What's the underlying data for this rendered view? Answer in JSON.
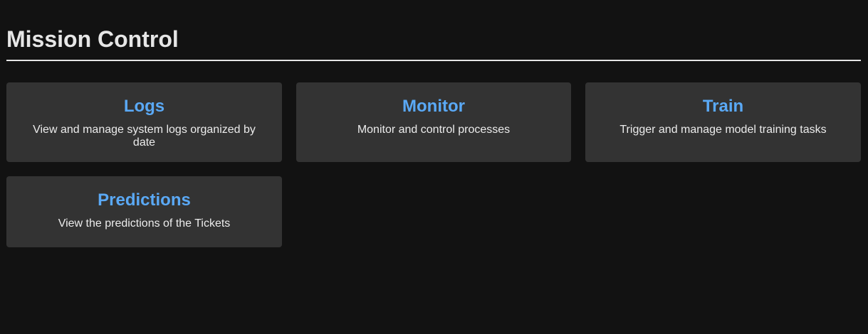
{
  "header": {
    "title": "Mission Control"
  },
  "colors": {
    "background": "#121212",
    "card_background": "#333333",
    "card_title": "#5aa9f6",
    "text": "#e6e6e6"
  },
  "cards": [
    {
      "title": "Logs",
      "description": "View and manage system logs organized by date"
    },
    {
      "title": "Monitor",
      "description": "Monitor and control processes"
    },
    {
      "title": "Train",
      "description": "Trigger and manage model training tasks"
    },
    {
      "title": "Predictions",
      "description": "View the predictions of the Tickets"
    }
  ]
}
